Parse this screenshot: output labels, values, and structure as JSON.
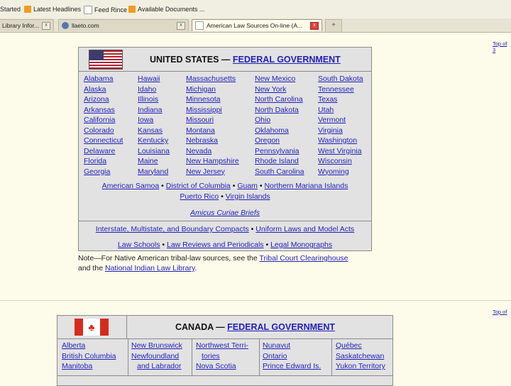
{
  "bookmarks": [
    {
      "label": "Started",
      "icon": "page-icon"
    },
    {
      "label": "Latest Headlines",
      "icon": "rss-icon"
    },
    {
      "label": "Feed Rince",
      "icon": "page-icon"
    },
    {
      "label": "Available Documents ...",
      "icon": "rss-icon"
    }
  ],
  "tabs": [
    {
      "label": "Library Infor...",
      "close": "x"
    },
    {
      "label": "llaeto.com",
      "close": "x"
    },
    {
      "label": "American Law Sources On-line (A...",
      "close": "x"
    }
  ],
  "new_tab": "+",
  "top_link_1": "Top of 3",
  "top_link_2": "Top of",
  "us": {
    "title_prefix": "UNITED STATES —",
    "title_link": "FEDERAL GOVERNMENT",
    "columns": [
      [
        "Alabama",
        "Alaska",
        "Arizona",
        "Arkansas",
        "California",
        "Colorado",
        "Connecticut",
        "Delaware",
        "Florida",
        "Georgia"
      ],
      [
        "Hawaii",
        "Idaho",
        "Illinois",
        "Indiana",
        "Iowa",
        "Kansas",
        "Kentucky",
        "Louisiana",
        "Maine",
        "Maryland"
      ],
      [
        "Massachusetts",
        "Michigan",
        "Minnesota",
        "Mississippi",
        "Missouri",
        "Montana",
        "Nebraska",
        "Nevada",
        "New Hampshire",
        "New Jersey"
      ],
      [
        "New Mexico",
        "New York",
        "North Carolina",
        "North Dakota",
        "Ohio",
        "Oklahoma",
        "Oregon",
        "Pennsylvania",
        "Rhode Island",
        "South Carolina"
      ],
      [
        "South Dakota",
        "Tennessee",
        "Texas",
        "Utah",
        "Vermont",
        "Virginia",
        "Washington",
        "West Virginia",
        "Wisconsin",
        "Wyoming"
      ]
    ],
    "territories_1": [
      "American Samoa",
      "District of Columbia",
      "Guam",
      "Northern Mariana Islands"
    ],
    "territories_2": [
      "Puerto Rico",
      "Virgin Islands"
    ],
    "amicus": "Amicus Curiae Briefs",
    "compacts": [
      "Interstate, Multistate, and Boundary Compacts",
      "Uniform Laws and Model Acts"
    ],
    "schools": [
      "Law Schools",
      "Law Reviews and Periodicals",
      "Legal Monographs"
    ],
    "separator": "•"
  },
  "note": {
    "prefix": "Note—For Native American tribal-law sources, see the",
    "link1": "Tribal Court Clearinghouse",
    "middle": "and the",
    "link2": "National Indian Law Library",
    "suffix": "."
  },
  "canada": {
    "title_prefix": "CANADA —",
    "title_link": "FEDERAL GOVERNMENT",
    "columns": [
      [
        "Alberta",
        "British Columbia",
        "Manitoba"
      ],
      [
        "New Brunswick",
        "Newfoundland",
        "and Labrador"
      ],
      [
        "Northwest Terri-",
        "tories",
        "Nova Scotia"
      ],
      [
        "Nunavut",
        "Ontario",
        "Prince Edward Is."
      ],
      [
        "Québec",
        "Saskatchewan",
        "Yukon Territory"
      ]
    ]
  },
  "colors": {
    "link": "#1f1fb8",
    "table_bg": "#e2e2e2",
    "page_bg": "#fdfbea"
  }
}
